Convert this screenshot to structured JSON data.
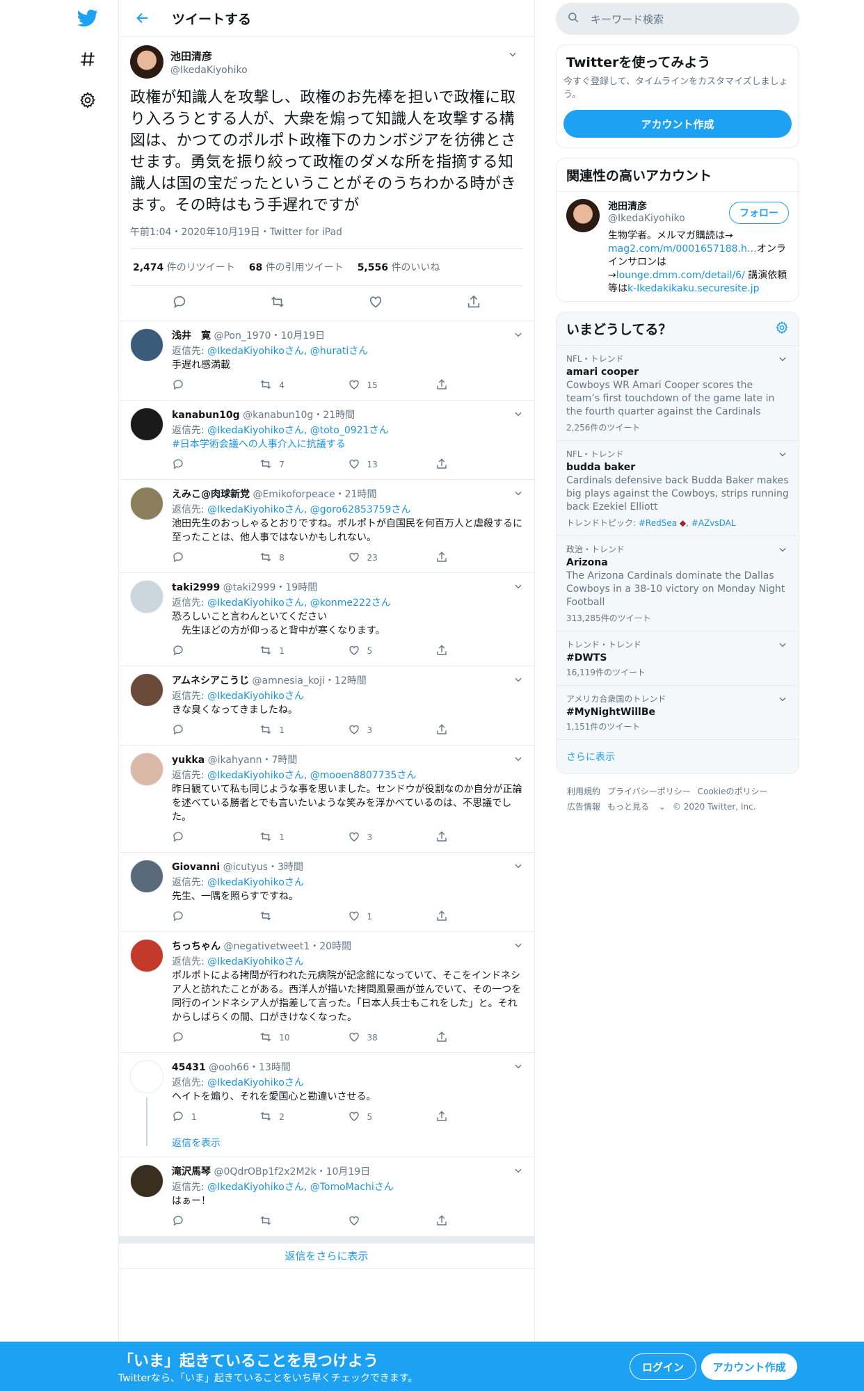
{
  "header": {
    "title": "ツイートする"
  },
  "focal": {
    "name": "池田清彦",
    "handle": "@IkedaKiyohiko",
    "text": "政権が知識人を攻撃し、政権のお先棒を担いで政権に取り入ろうとする人が、大衆を煽って知識人を攻撃する構図は、かつてのポルポト政権下のカンボジアを彷彿とさせます。勇気を振り絞って政権のダメな所を指摘する知識人は国の宝だったということがそのうちわかる時がきます。その時はもう手遅れですが",
    "meta": "午前1:04・2020年10月19日・Twitter for iPad",
    "retweets": "2,474",
    "retweets_label": "件のリツイート",
    "quotes": "68",
    "quotes_label": "件の引用ツイート",
    "likes": "5,556",
    "likes_label": "件のいいね"
  },
  "replies": [
    {
      "name": "浅井　寛",
      "handle": "@Pon_1970",
      "time": "10月19日",
      "to_prefix": "返信先: ",
      "to": "@IkedaKiyohikoさん, @huratiさん",
      "text": "手遅れ感満載",
      "reply": "",
      "rt": "4",
      "like": "15",
      "av": "#3b5b7a"
    },
    {
      "name": "kanabun10g",
      "handle": "@kanabun10g",
      "time": "21時間",
      "to_prefix": "返信先: ",
      "to": "@IkedaKiyohikoさん, @toto_0921さん",
      "text": "#日本学術会議への人事介入に抗議する",
      "text_link": true,
      "reply": "",
      "rt": "7",
      "like": "13",
      "av": "#1a1a1a"
    },
    {
      "name": "えみこ@肉球新党",
      "handle": "@Emikoforpeace",
      "time": "21時間",
      "to_prefix": "返信先: ",
      "to": "@IkedaKiyohikoさん, @goro62853759さん",
      "text": "池田先生のおっしゃるとおりですね。ポルポトが自国民を何百万人と虐殺するに至ったことは、他人事ではないかもしれない。",
      "reply": "",
      "rt": "8",
      "like": "23",
      "av": "#8a7f5a"
    },
    {
      "name": "taki2999",
      "handle": "@taki2999",
      "time": "19時間",
      "to_prefix": "返信先: ",
      "to": "@IkedaKiyohikoさん, @konme222さん",
      "text": "恐ろしいこと言わんといてください\n　先生ほどの方が仰っると背中が寒くなります。",
      "reply": "",
      "rt": "1",
      "like": "5",
      "av": "#ccd6dd"
    },
    {
      "name": "アムネシアこうじ",
      "handle": "@amnesia_koji",
      "time": "12時間",
      "to_prefix": "返信先: ",
      "to": "@IkedaKiyohikoさん",
      "text": "きな臭くなってきましたね。",
      "reply": "",
      "rt": "1",
      "like": "3",
      "av": "#6b4a3a"
    },
    {
      "name": "yukka",
      "handle": "@ikahyann",
      "time": "7時間",
      "to_prefix": "返信先: ",
      "to": "@IkedaKiyohikoさん, @mooen8807735さん",
      "text": "昨日観ていて私も同じような事を思いました。センドウが役割なのか自分が正論を述べている勝者とでも言いたいような笑みを浮かべているのは、不思議でした。",
      "reply": "",
      "rt": "1",
      "like": "3",
      "av": "#d9b8a8"
    },
    {
      "name": "Giovanni",
      "handle": "@icutyus",
      "time": "3時間",
      "to_prefix": "返信先: ",
      "to": "@IkedaKiyohikoさん",
      "text": "先生、一隅を照らすですね。",
      "reply": "",
      "rt": "",
      "like": "1",
      "av": "#5a6a7a"
    },
    {
      "name": "ちっちゃん",
      "handle": "@negativetweet1",
      "time": "20時間",
      "to_prefix": "返信先: ",
      "to": "@IkedaKiyohikoさん",
      "text": "ポルポトによる拷問が行われた元病院が記念館になっていて、そこをインドネシア人と訪れたことがある。西洋人が描いた拷問風景画が並んでいて、その一つを同行のインドネシア人が指差して言った。「日本人兵士もこれをした」と。それからしばらくの間、口がきけなくなった。",
      "reply": "",
      "rt": "10",
      "like": "38",
      "av": "#c43a2a"
    },
    {
      "name": "45431",
      "handle": "@ooh66",
      "time": "13時間",
      "to_prefix": "返信先: ",
      "to": "@IkedaKiyohikoさん",
      "text": "ヘイトを煽り、それを愛国心と勘違いさせる。",
      "reply": "1",
      "rt": "2",
      "like": "5",
      "av": "#ffffff",
      "showthread": "返信を表示"
    },
    {
      "name": "滝沢馬琴",
      "handle": "@0QdrOBp1f2x2M2k",
      "time": "10月19日",
      "to_prefix": "返信先: ",
      "to": "@IkedaKiyohikoさん, @TomoMachiさん",
      "text": "はぁー！",
      "reply": "",
      "rt": "",
      "like": "",
      "av": "#3a2e20"
    }
  ],
  "show_more": "返信をさらに表示",
  "search": {
    "placeholder": "キーワード検索"
  },
  "signup": {
    "title": "Twitterを使ってみよう",
    "desc": "今すぐ登録して、タイムラインをカスタマイズしましょう。",
    "button": "アカウント作成"
  },
  "related": {
    "title": "関連性の高いアカウント",
    "name": "池田清彦",
    "handle": "@IkedaKiyohiko",
    "follow": "フォロー",
    "bio1": "生物学者。メルマガ購読は→",
    "link1": "mag2.com/m/0001657188.h…",
    "bio2": "オンラインサロンは→",
    "link2": "lounge.dmm.com/detail/6/",
    "bio3": " 講演依頼等は",
    "link3": "k-Ikedakikaku.securesite.jp"
  },
  "trends": {
    "title": "いまどうしてる？",
    "items": [
      {
        "meta": "NFL・トレンド",
        "name": "amari cooper",
        "desc": "Cowboys WR Amari Cooper scores the team’s first touchdown of the game late in the fourth quarter against the Cardinals",
        "count": "2,256件のツイート"
      },
      {
        "meta": "NFL・トレンド",
        "name": "budda baker",
        "desc": "Cardinals defensive back Budda Baker makes big plays against the Cowboys, strips running back Ezekiel Elliott",
        "count": "トレンドトピック: ",
        "tag1": "#RedSea",
        "tag2": "#AZvsDAL"
      },
      {
        "meta": "政治・トレンド",
        "name": "Arizona",
        "desc": "The Arizona Cardinals dominate the Dallas Cowboys in a 38-10 victory on Monday Night Football",
        "count": "313,285件のツイート"
      },
      {
        "meta": "トレンド・トレンド",
        "name": "#DWTS",
        "desc": "",
        "count": "16,119件のツイート"
      },
      {
        "meta": "アメリカ合衆国のトレンド",
        "name": "#MyNightWillBe",
        "desc": "",
        "count": "1,151件のツイート"
      }
    ],
    "more": "さらに表示"
  },
  "footer": {
    "l1": "利用規約",
    "l2": "プライバシーポリシー",
    "l3": "Cookieのポリシー",
    "l4": "広告情報",
    "l5": "もっと見る",
    "copy": "© 2020 Twitter, Inc."
  },
  "bottom": {
    "title": "「いま」起きていることを見つけよう",
    "sub": "Twitterなら、「いま」起きていることをいち早くチェックできます。",
    "login": "ログイン",
    "signup": "アカウント作成"
  }
}
